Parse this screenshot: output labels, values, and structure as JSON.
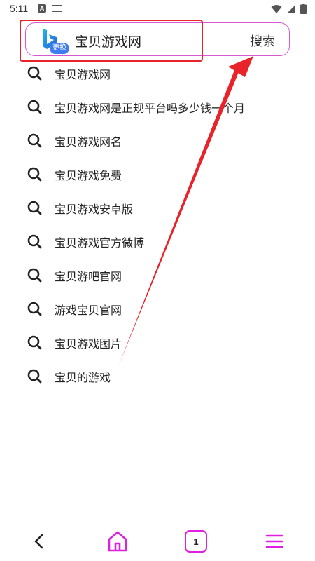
{
  "status_bar": {
    "time": "5:11",
    "notification_icon_label": "A"
  },
  "search_bar": {
    "query": "宝贝游戏网",
    "switch_engine_label": "更换",
    "search_button_label": "搜索",
    "accent_color": "#d45ad4"
  },
  "suggestions": [
    {
      "text": "宝贝游戏网"
    },
    {
      "text": "宝贝游戏网是正规平台吗多少钱一个月"
    },
    {
      "text": "宝贝游戏网名"
    },
    {
      "text": "宝贝游戏免费"
    },
    {
      "text": "宝贝游戏安卓版"
    },
    {
      "text": "宝贝游戏官方微博"
    },
    {
      "text": "宝贝游吧官网"
    },
    {
      "text": "游戏宝贝官网"
    },
    {
      "text": "宝贝游戏图片"
    },
    {
      "text": "宝贝的游戏"
    }
  ],
  "bottom_nav": {
    "tab_count": "1",
    "icon_color": "#e020e0"
  },
  "annotation": {
    "highlight_color": "#e8232a"
  }
}
